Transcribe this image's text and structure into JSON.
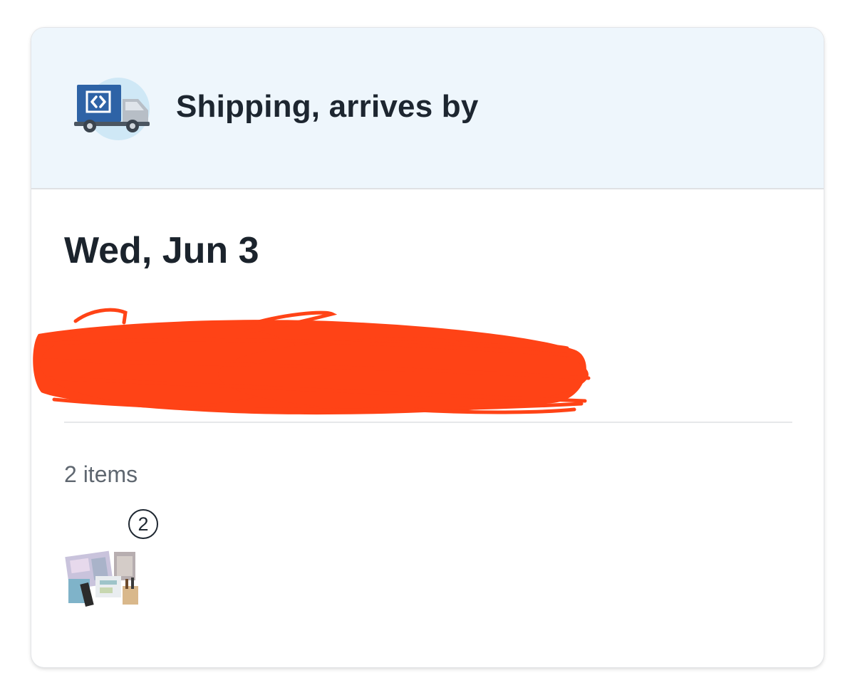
{
  "shipping": {
    "header_title": "Shipping, arrives by",
    "header_icon": "delivery-truck-icon",
    "arrival_date": "Wed, Jun 3",
    "items_count_label": "2 items",
    "item_quantity": "2",
    "item_thumbnail_icon": "product-collage-thumbnail"
  },
  "colors": {
    "header_background": "#eef6fc",
    "truck_box": "#2e63a6",
    "redaction_scribble": "#ff4316",
    "text_primary": "#1b232c",
    "text_secondary": "#5f6770"
  }
}
